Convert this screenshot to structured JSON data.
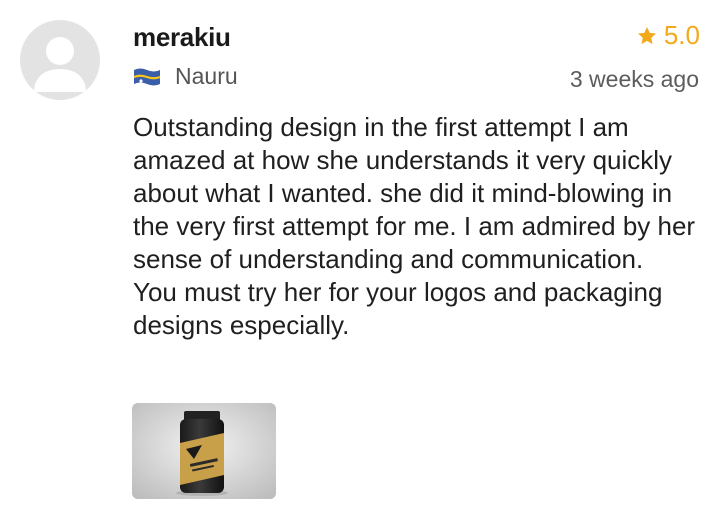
{
  "review": {
    "username": "merakiu",
    "rating": "5.0",
    "country": "Nauru",
    "timestamp": "3 weeks ago",
    "paragraphs": [
      "Outstanding design in the first attempt I am amazed at how she understands it very quickly about what I wanted. she did it mind-blowing in the very first attempt for me. I am admired by her sense of understanding and communication.",
      "You must try her for your logos and packaging designs especially."
    ],
    "attachment_icon": "product-jar-image"
  },
  "colors": {
    "star": "#f2a91c",
    "avatar_bg": "#e3e3e3",
    "avatar_fg": "#ffffff",
    "flag_blue": "#3b5ea8",
    "flag_gold": "#f5c518"
  },
  "icons": {
    "avatar": "user-placeholder-icon",
    "star": "star-icon",
    "flag": "nauru-flag-icon"
  }
}
